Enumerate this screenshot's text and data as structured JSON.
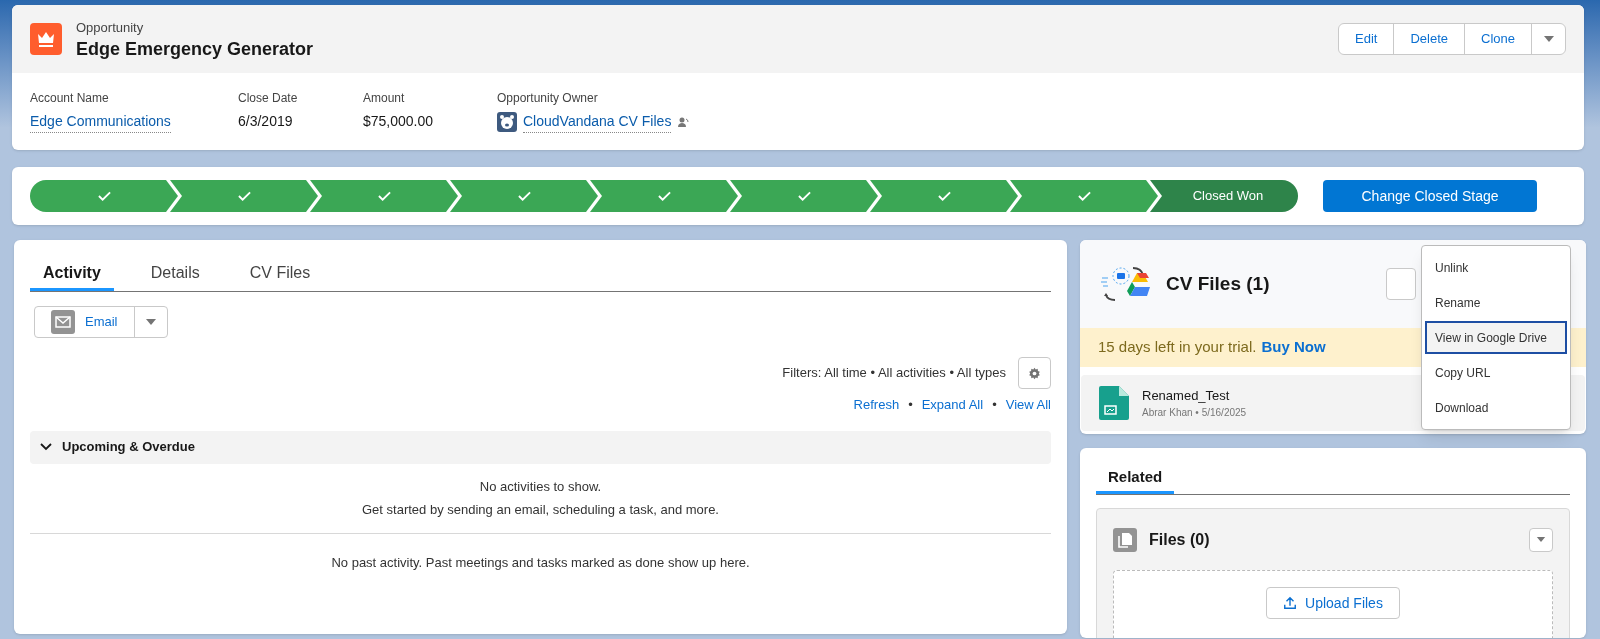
{
  "record": {
    "object_type": "Opportunity",
    "title": "Edge Emergency Generator",
    "actions": [
      "Edit",
      "Delete",
      "Clone"
    ],
    "fields": [
      {
        "label": "Account Name",
        "value": "Edge Communications",
        "kind": "link"
      },
      {
        "label": "Close Date",
        "value": "6/3/2019",
        "kind": "text"
      },
      {
        "label": "Amount",
        "value": "$75,000.00",
        "kind": "text"
      },
      {
        "label": "Opportunity Owner",
        "value": "CloudVandana CV Files",
        "kind": "owner"
      }
    ]
  },
  "path": {
    "stages": [
      {
        "complete": true,
        "current": false
      },
      {
        "complete": true,
        "current": false
      },
      {
        "complete": true,
        "current": false
      },
      {
        "complete": true,
        "current": false
      },
      {
        "complete": true,
        "current": false
      },
      {
        "complete": true,
        "current": false
      },
      {
        "complete": true,
        "current": false
      },
      {
        "complete": true,
        "current": false
      },
      {
        "current": true,
        "label": "Closed Won"
      }
    ],
    "button": "Change Closed Stage"
  },
  "activity": {
    "tabs": [
      {
        "label": "Activity",
        "selected": true
      },
      {
        "label": "Details",
        "selected": false
      },
      {
        "label": "CV Files",
        "selected": false
      }
    ],
    "email_button": "Email",
    "filters": "Filters: All time • All activities • All types",
    "links": [
      "Refresh",
      "Expand All",
      "View All"
    ],
    "link_separators": [
      "•",
      "•"
    ],
    "section": "Upcoming & Overdue",
    "empty_lines": [
      "No activities to show.",
      "Get started by sending an email, scheduling a task, and more."
    ],
    "past": "No past activity. Past meetings and tasks marked as done show up here."
  },
  "cv_files": {
    "title": "CV Files (1)",
    "trial_text": "15 days left in your trial.",
    "trial_link": "Buy Now",
    "files": [
      {
        "name": "Renamed_Test",
        "meta": "Abrar Khan • 5/16/2025"
      }
    ],
    "menu": [
      {
        "label": "Unlink",
        "selected": false
      },
      {
        "label": "Rename",
        "selected": false
      },
      {
        "label": "View in Google Drive",
        "selected": true
      },
      {
        "label": "Copy URL",
        "selected": false
      },
      {
        "label": "Download",
        "selected": false
      }
    ]
  },
  "related": {
    "tabs": [
      {
        "label": "Related",
        "selected": true
      }
    ],
    "files_title": "Files (0)",
    "upload_button": "Upload Files"
  }
}
